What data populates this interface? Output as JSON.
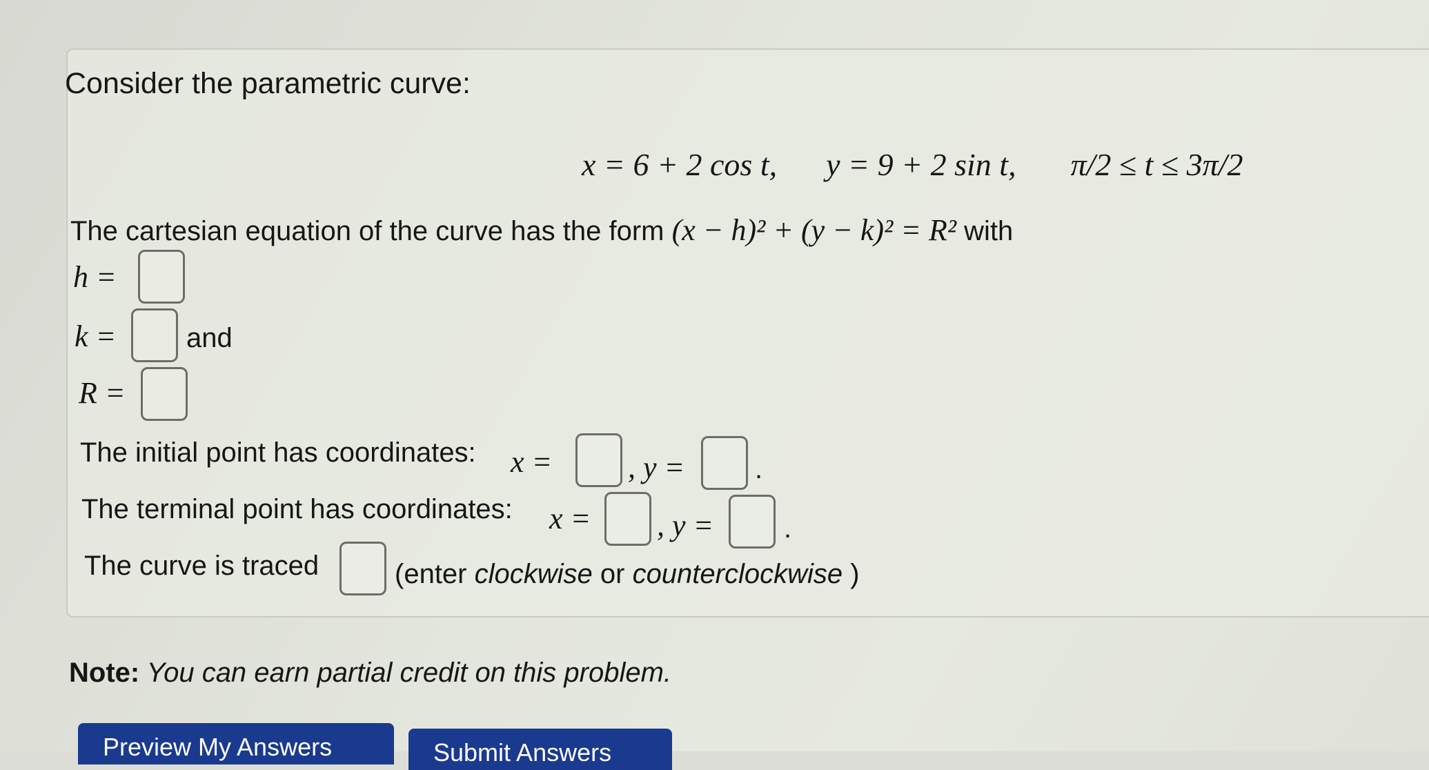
{
  "problem": {
    "intro": "Consider the parametric curve:",
    "parametric_equation": {
      "x_expr": "x = 6 + 2 cos t,",
      "y_expr": "y = 9 + 2 sin t,",
      "domain": "π/2 ≤ t ≤ 3π/2"
    },
    "cartesian_prompt": "The cartesian equation of the curve has the form",
    "cartesian_form": "(x − h)² + (y − k)² = R²",
    "cartesian_suffix": "with",
    "h_label": "h =",
    "k_label": "k =",
    "k_suffix": "and",
    "R_label": "R =",
    "initial_prompt": "The initial point has coordinates:",
    "terminal_prompt": "The terminal point has coordinates:",
    "x_label": "x =",
    "y_label": ", y =",
    "period": ".",
    "traced_prompt": "The curve is traced",
    "traced_hint_open": "(enter ",
    "traced_hint_opt1": "clockwise",
    "traced_hint_or": " or ",
    "traced_hint_opt2": "counterclockwise",
    "traced_hint_close": " )"
  },
  "answers": {
    "h": "",
    "k": "",
    "R": "",
    "initial_x": "",
    "initial_y": "",
    "terminal_x": "",
    "terminal_y": "",
    "direction": ""
  },
  "note": {
    "label": "Note:",
    "text": " You can earn partial credit on this problem."
  },
  "buttons": {
    "preview": "Preview My Answers",
    "submit": "Submit Answers"
  },
  "colors": {
    "button_bg": "#1a3a8f",
    "button_text": "#ffffff"
  }
}
